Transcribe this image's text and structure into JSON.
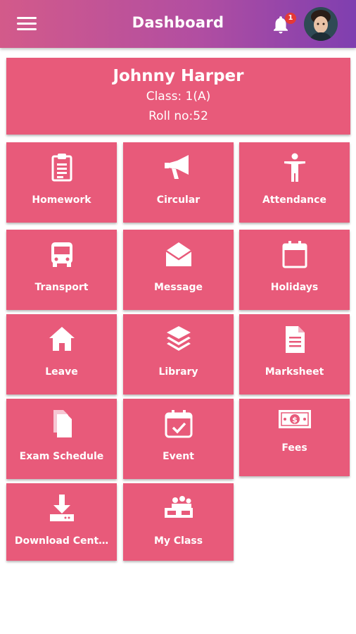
{
  "appbar": {
    "title": "Dashboard",
    "notification_count": "1"
  },
  "profile": {
    "name": "Johnny Harper",
    "class": "Class: 1(A)",
    "roll": "Roll no:52"
  },
  "tiles": [
    {
      "label": "Homework",
      "icon": "clipboard-icon"
    },
    {
      "label": "Circular",
      "icon": "megaphone-icon"
    },
    {
      "label": "Attendance",
      "icon": "person-icon"
    },
    {
      "label": "Transport",
      "icon": "bus-icon"
    },
    {
      "label": "Message",
      "icon": "envelope-icon"
    },
    {
      "label": "Holidays",
      "icon": "calendar-icon"
    },
    {
      "label": "Leave",
      "icon": "home-icon"
    },
    {
      "label": "Library",
      "icon": "layers-icon"
    },
    {
      "label": "Marksheet",
      "icon": "document-icon"
    },
    {
      "label": "Exam Schedule",
      "icon": "files-icon"
    },
    {
      "label": "Event",
      "icon": "calendar-check-icon"
    },
    {
      "label": "Fees",
      "icon": "money-icon"
    },
    {
      "label": "Download Cent…",
      "icon": "download-icon"
    },
    {
      "label": "My Class",
      "icon": "classroom-icon"
    }
  ],
  "colors": {
    "tile": "#e85a7a",
    "appbar_start": "#d35a8a",
    "appbar_end": "#7f3fb0"
  }
}
